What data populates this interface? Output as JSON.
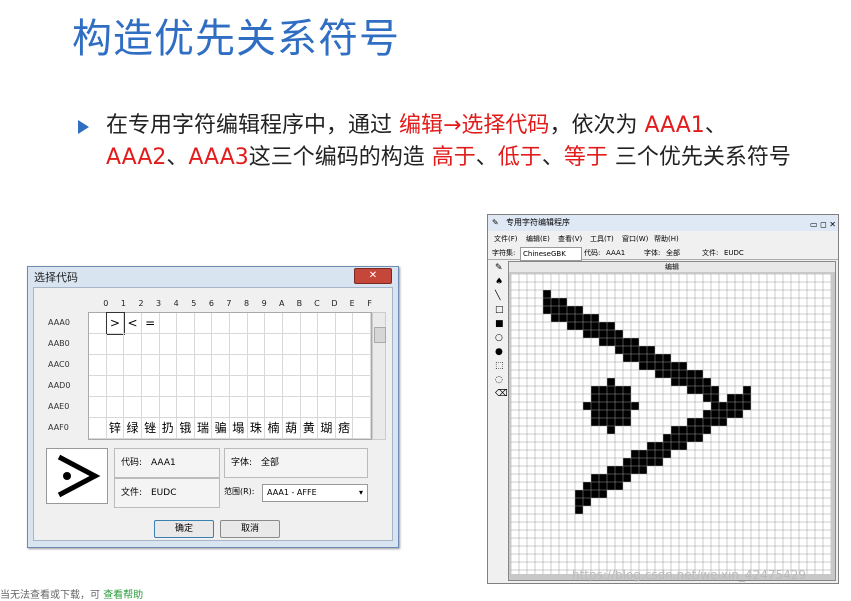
{
  "slide": {
    "title": "构造优先关系符号",
    "para": {
      "t1": "在专用字符编辑程序中，通过 ",
      "t2": "编辑→选择代码",
      "t3": "，依次为 ",
      "t4": "AAA1",
      "t5": "、",
      "t6": "AAA2",
      "t7": "、",
      "t8": "AAA3",
      "t9": "这三个编码的构造 ",
      "t10": "高于",
      "t11": "、",
      "t12": "低于",
      "t13": "、",
      "t14": "等于",
      "t15": " 三个优先关系符号"
    }
  },
  "dialog": {
    "title": "选择代码",
    "hex_headers": [
      "0",
      "1",
      "2",
      "3",
      "4",
      "5",
      "6",
      "7",
      "8",
      "9",
      "A",
      "B",
      "C",
      "D",
      "E",
      "F"
    ],
    "row_labels": [
      "AAA0",
      "AAB0",
      "AAC0",
      "AAD0",
      "AAE0",
      "AAF0"
    ],
    "row0_glyphs": [
      "",
      ">",
      "<",
      "=",
      "",
      "",
      "",
      "",
      "",
      "",
      "",
      "",
      "",
      "",
      "",
      ""
    ],
    "rowF_glyphs": [
      "",
      "锌",
      "绿",
      "锉",
      "扔",
      "锇",
      "瑞",
      "骗",
      "塌",
      "珠",
      "楠",
      "葫",
      "黄",
      "瑚",
      "痞",
      ""
    ],
    "preview_glyph": ">",
    "code_label": "代码:",
    "code_value": "AAA1",
    "font_label": "字体:",
    "font_value": "全部",
    "file_label": "文件:",
    "file_value": "EUDC",
    "range_label": "范围(R):",
    "range_value": "AAA1 - AFFE",
    "ok": "确定",
    "cancel": "取消",
    "close_icon": "close-icon"
  },
  "editor": {
    "title": "专用字符编辑程序",
    "controls": "▭ ◻ ✕",
    "menus": [
      "文件(F)",
      "编辑(E)",
      "查看(V)",
      "工具(T)",
      "窗口(W)",
      "帮助(H)"
    ],
    "charset_label": "字符集:",
    "charset_value": "ChineseGBK",
    "code_label": "代码:",
    "code_value": "AAA1",
    "font_label": "字体:",
    "font_value": "全部",
    "file_label": "文件:",
    "file_value": "EUDC",
    "canvas_header": "编辑",
    "tools": [
      "pencil-icon",
      "brush-icon",
      "line-icon",
      "rect-hollow-icon",
      "rect-filled-icon",
      "ellipse-hollow-icon",
      "ellipse-filled-icon",
      "select-rect-icon",
      "select-free-icon",
      "eraser-icon"
    ]
  },
  "watermark": "https://blog.csdn.net/weixin_42475429",
  "footer": {
    "text": "当无法查看或下载，可",
    "link": "查看帮助"
  }
}
